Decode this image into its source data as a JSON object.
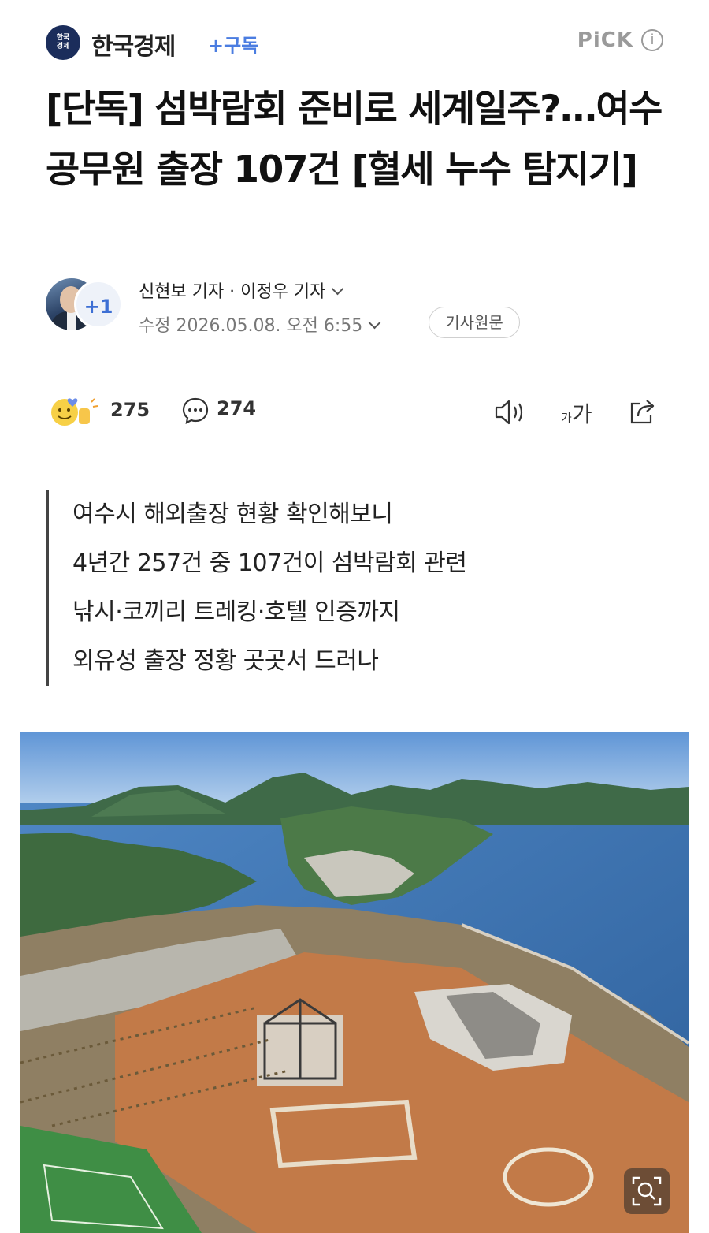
{
  "press": {
    "logo_text": "한국\n경제",
    "name": "한국경제",
    "subscribe_label": "+구독",
    "pick_label": "PiCK",
    "info_label": "i"
  },
  "article": {
    "title": "[단독] 섬박람회 준비로 세계일주?…여수 공무원 출장 107건 [혈세 누수 탐지기]",
    "reporters": "신현보 기자 · 이정우 기자",
    "extra_reporters_badge": "+1",
    "date_line": "수정 2026.05.08. 오전 6:55",
    "source_button": "기사원문"
  },
  "actions": {
    "reaction_count": "275",
    "comment_count": "274",
    "font_small": "가",
    "font_big": "가"
  },
  "summary": [
    "여수시 해외출장 현황 확인해보니",
    "4년간 257건 중 107건이 섬박람회 관련",
    "낚시·코끼리 트레킹·호텔 인증까지",
    "외유성 출장 정황 곳곳서 드러나"
  ],
  "icons": {
    "reaction": "emoji-reactions-icon",
    "comment": "comment-bubble-icon",
    "tts": "speaker-icon",
    "share": "share-icon",
    "zoom": "magnify-icon"
  },
  "colors": {
    "accent": "#4b7de1",
    "press_logo": "#1b2d5b",
    "muted": "#9a9a9a"
  }
}
